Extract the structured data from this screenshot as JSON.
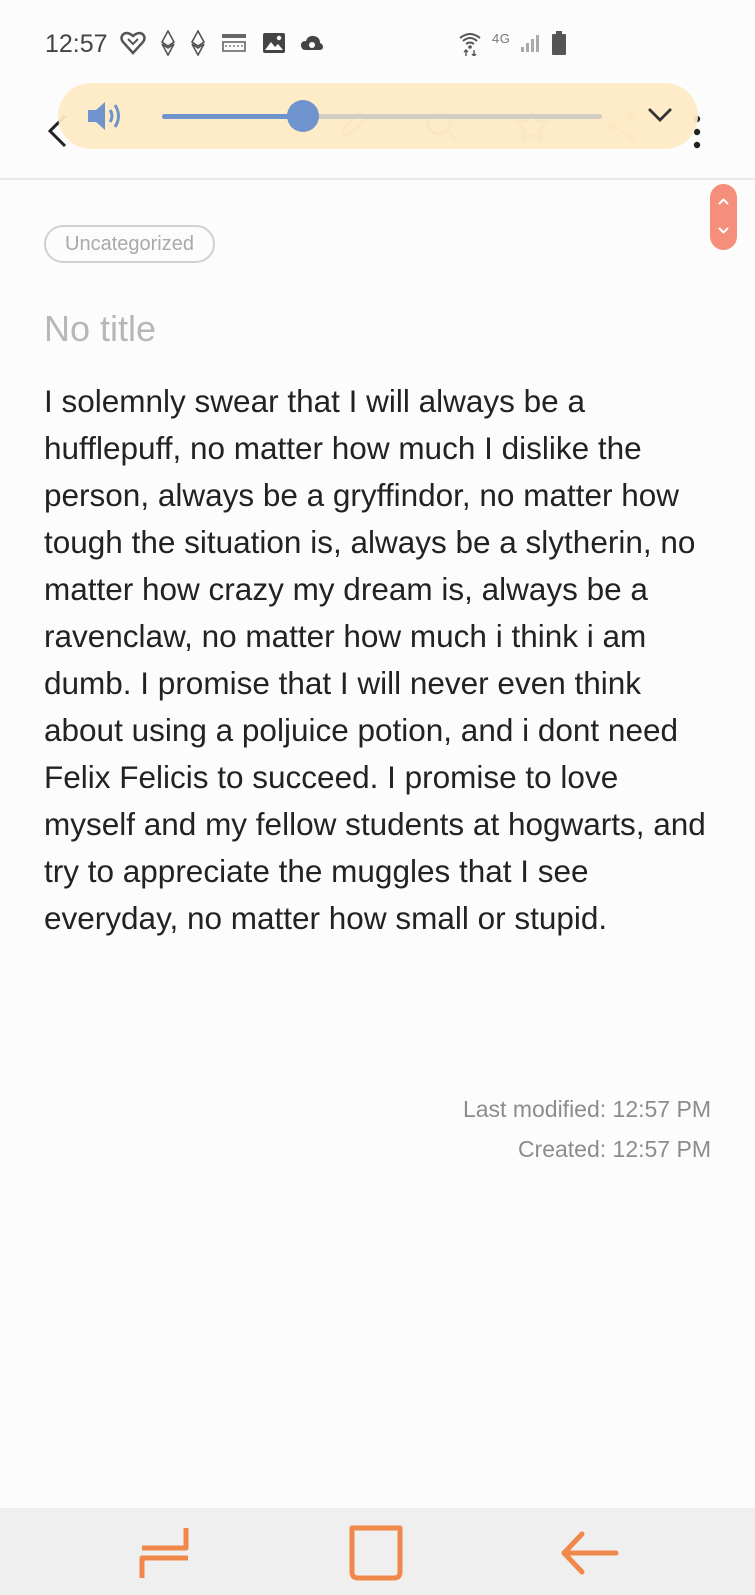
{
  "status_bar": {
    "time": "12:57",
    "network_label": "4G",
    "icons_left": [
      "heart-outline-icon",
      "ethereum-icon",
      "ethereum-icon",
      "amazon-icon",
      "gallery-icon",
      "cloud-icon"
    ],
    "icons_right": [
      "wifi-icon",
      "signal-icon",
      "battery-icon"
    ]
  },
  "app_bar": {
    "icons": [
      "back-icon",
      "edit-icon",
      "search-icon",
      "star-icon",
      "share-icon",
      "more-vertical-icon"
    ]
  },
  "tts": {
    "progress": 0.32,
    "accent_color": "#6f93cc",
    "pill_color": "#feebc4"
  },
  "note": {
    "category": "Uncategorized",
    "title_placeholder": "No title",
    "body": "I solemnly swear that I will always be a hufflepuff, no matter how much I dislike the person, always be a gryffindor, no matter how tough the situation is, always be a slytherin, no matter how crazy my dream is, always be a ravenclaw, no matter how much i think i am dumb. I promise that I will never even think about using a poljuice potion, and i dont need Felix Felicis to succeed. I promise to love myself and my fellow students at hogwarts, and try to appreciate the muggles that I see everyday, no matter how small or stupid.",
    "last_modified": "Last modified: 12:57 PM",
    "created": "Created: 12:57 PM"
  },
  "nav_bar": {
    "accent_color": "#f0884a",
    "items": [
      "recent-apps",
      "home",
      "back"
    ]
  }
}
